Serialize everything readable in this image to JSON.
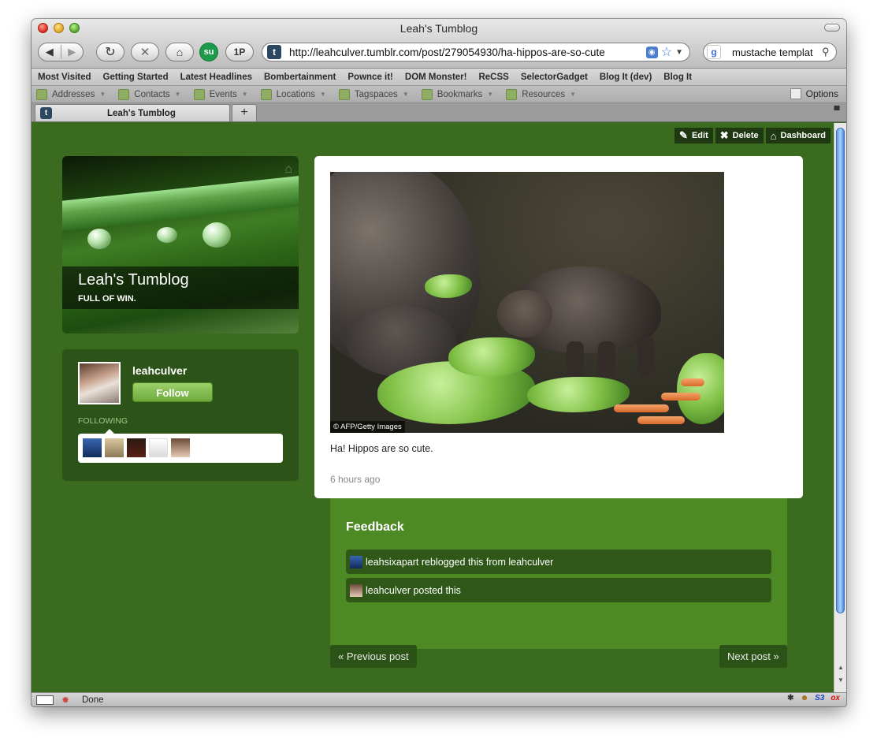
{
  "window": {
    "title": "Leah's Tumblog"
  },
  "toolbar": {
    "onep_label": "1P",
    "url": "http://leahculver.tumblr.com/post/279054930/ha-hippos-are-so-cute",
    "search_value": "mustache templat"
  },
  "bookmarks": [
    "Most Visited",
    "Getting Started",
    "Latest Headlines",
    "Bombertainment",
    "Pownce it!",
    "DOM Monster!",
    "ReCSS",
    "SelectorGadget",
    "Blog It (dev)",
    "Blog It"
  ],
  "addons": [
    "Addresses",
    "Contacts",
    "Events",
    "Locations",
    "Tagspaces",
    "Bookmarks",
    "Resources"
  ],
  "addons_options": "Options",
  "tab": {
    "label": "Leah's Tumblog",
    "new_tab": "+"
  },
  "admin": {
    "edit": "Edit",
    "delete": "Delete",
    "dashboard": "Dashboard"
  },
  "blog": {
    "title": "Leah's Tumblog",
    "subtitle": "FULL OF WIN."
  },
  "profile": {
    "username": "leahculver",
    "follow_label": "Follow",
    "following_label": "FOLLOWING"
  },
  "post": {
    "photo_credit": "© AFP/Getty Images",
    "caption": "Ha! Hippos are so cute.",
    "timestamp": "6 hours ago"
  },
  "feedback": {
    "title": "Feedback",
    "items": [
      {
        "text": "leahsixapart reblogged this from leahculver"
      },
      {
        "text": "leahculver posted this"
      }
    ]
  },
  "pager": {
    "prev": "« Previous post",
    "next": "Next post »"
  },
  "status": {
    "text": "Done",
    "s3": "S3",
    "ox": "ox"
  }
}
